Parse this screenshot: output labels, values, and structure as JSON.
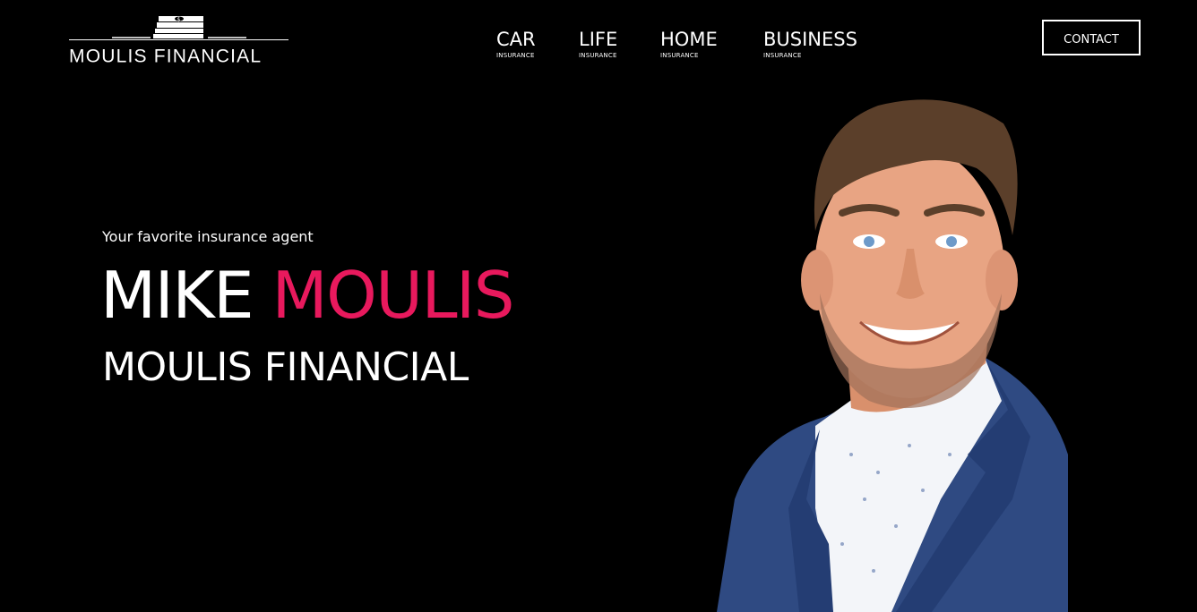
{
  "header": {
    "logo_text": "MOULIS FINANCIAL",
    "nav": [
      {
        "label": "CAR",
        "sub": "INSURANCE"
      },
      {
        "label": "LIFE",
        "sub": "INSURANCE"
      },
      {
        "label": "HOME",
        "sub": "INSURANCE"
      },
      {
        "label": "BUSINESS",
        "sub": "INSURANCE"
      }
    ],
    "contact_label": "CONTACT"
  },
  "hero": {
    "tagline": "Your favorite insurance agent",
    "first_name": "MIKE",
    "last_name": "MOULIS",
    "company": "MOULIS FINANCIAL"
  },
  "icons": {
    "logo_mark": "money-stack-icon"
  },
  "colors": {
    "background": "#000000",
    "text": "#ffffff",
    "accent": "#e8195d",
    "suit": "#2f4a82",
    "shirt": "#f3f5f9",
    "skin": "#e8a483",
    "hair": "#5b3f2a"
  }
}
